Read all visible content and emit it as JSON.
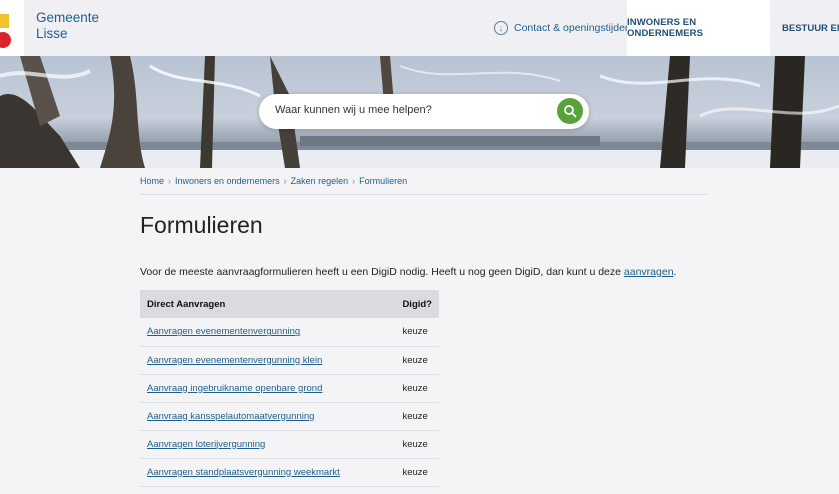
{
  "header": {
    "brand_line1": "Gemeente",
    "brand_line2": "Lisse",
    "contact_label": "Contact & openingstijden",
    "tab_residents": "INWONERS EN ONDERNEMERS",
    "tab_governance": "BESTUUR EN O"
  },
  "search": {
    "placeholder": "Waar kunnen wij u mee helpen?"
  },
  "breadcrumb": [
    "Home",
    "Inwoners en ondernemers",
    "Zaken regelen",
    "Formulieren"
  ],
  "page": {
    "title": "Formulieren",
    "intro": "Voor de meeste aanvraagformulieren heeft u een DigiD nodig. Heeft u nog geen DigiD, dan kunt u deze ",
    "intro_link": "aanvragen",
    "intro_end": "."
  },
  "table": {
    "headers": [
      "Direct Aanvragen",
      "Digid?"
    ],
    "rows": [
      {
        "name": "Aanvragen evenementenvergunning",
        "digid": "keuze"
      },
      {
        "name": "Aanvragen evenementenvergunning klein",
        "digid": "keuze"
      },
      {
        "name": "Aanvraag ingebruikname openbare grond",
        "digid": "keuze"
      },
      {
        "name": "Aanvraag kansspelautomaatvergunning",
        "digid": "keuze"
      },
      {
        "name": "Aanvragen loterijvergunning",
        "digid": "keuze"
      },
      {
        "name": "Aanvragen standplaatsvergunning weekmarkt",
        "digid": "keuze"
      }
    ]
  }
}
